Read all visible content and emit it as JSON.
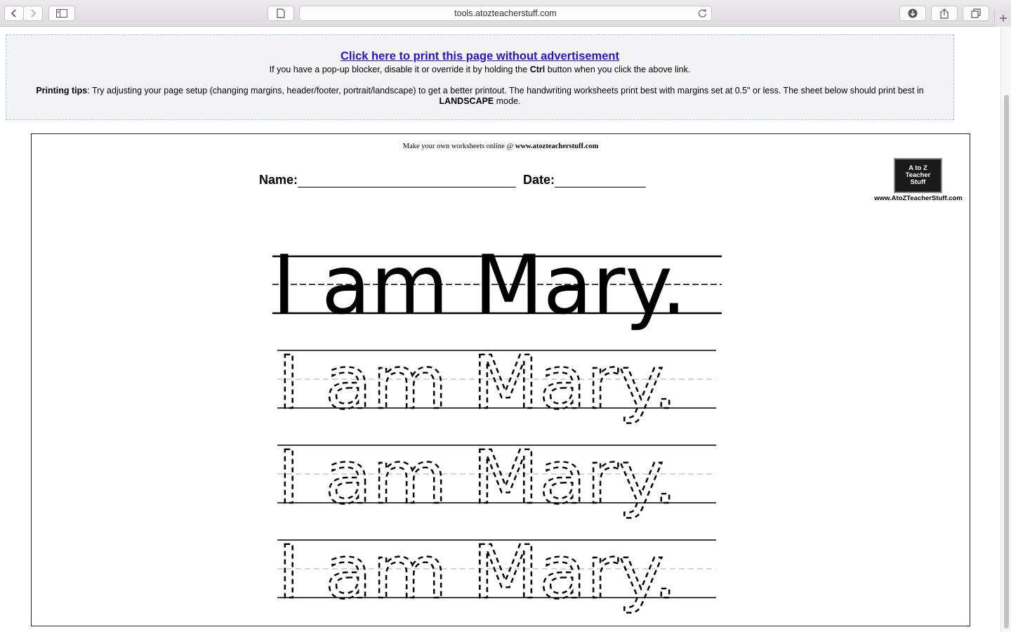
{
  "browser": {
    "url": "tools.atozteacherstuff.com"
  },
  "notice": {
    "print_link": "Click here to print this page without advertisement",
    "popup_text_before": "If you have a pop-up blocker, disable it or override it by holding the ",
    "popup_key": "Ctrl",
    "popup_text_after": " button when you click the above link.",
    "tips_label": "Printing tips",
    "tips_text": ": Try adjusting your page setup (changing margins, header/footer, portrait/landscape) to get a better printout. The handwriting worksheets print best with margins set at 0.5\" or less. The sheet below should print best in ",
    "tips_mode": "LANDSCAPE",
    "tips_end": " mode."
  },
  "worksheet": {
    "credit_prefix": "Make your own worksheets online @ ",
    "credit_site": "www.atozteacherstuff.com",
    "name_label": "Name:",
    "date_label": "Date:",
    "logo_lines": [
      "A to Z",
      "Teacher",
      "Stuff"
    ],
    "logo_url": "www.AtoZTeacherStuff.com",
    "sentence": "I am Mary.",
    "trace_rows": 3
  }
}
